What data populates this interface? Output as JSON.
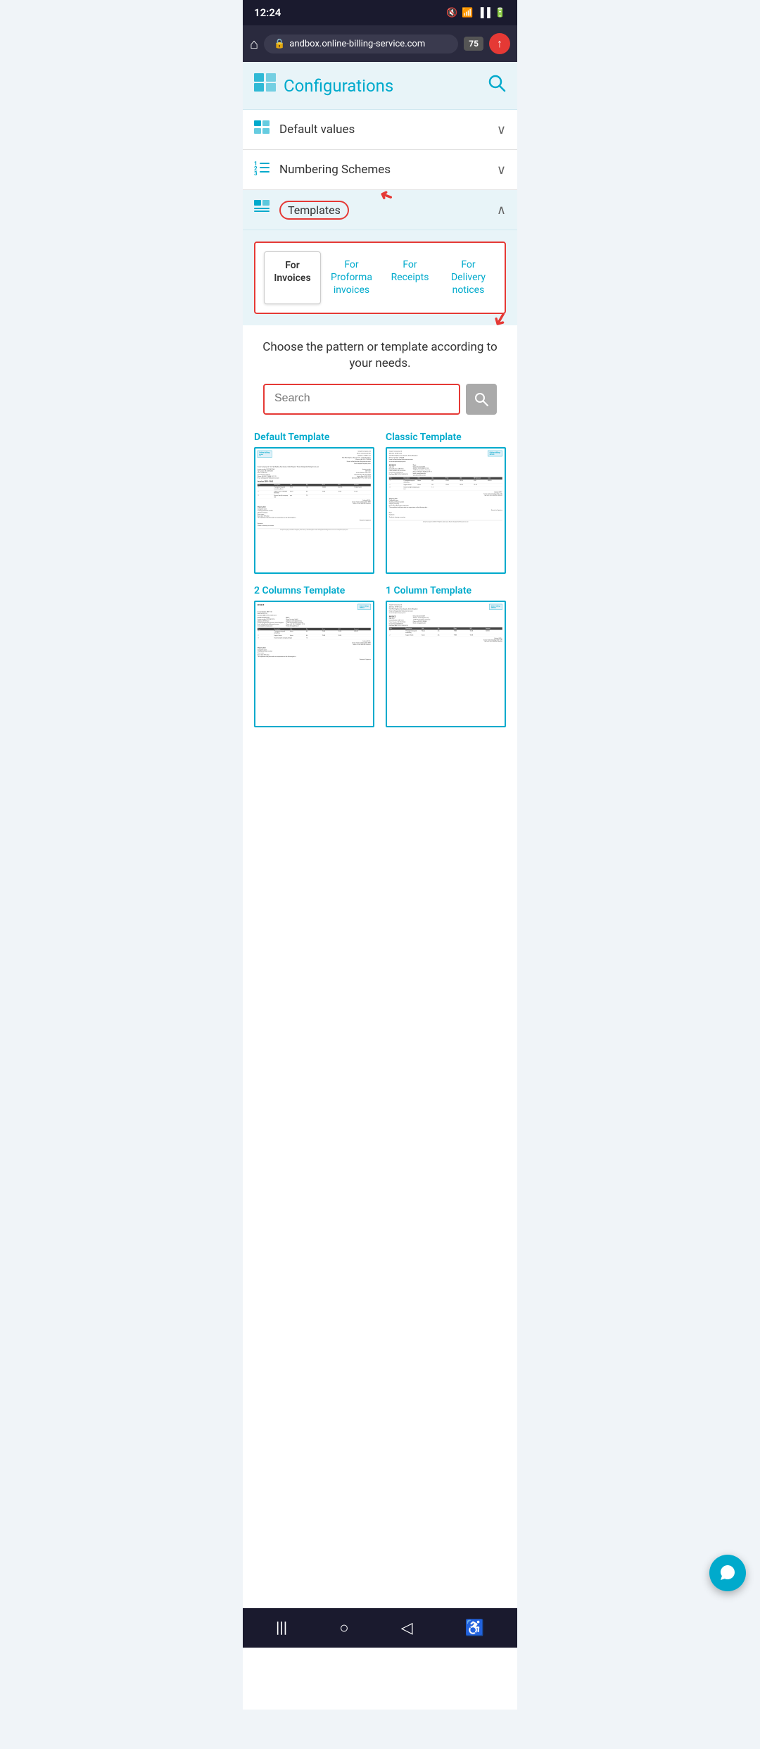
{
  "statusBar": {
    "time": "12:24",
    "personIcon": "🧑",
    "wifiIcon": "📶",
    "signalIcon": "📶",
    "batteryIcon": "🔋"
  },
  "browserBar": {
    "homeIcon": "⌂",
    "lockIcon": "🔒",
    "url": "andbox.online-billing-service.com",
    "tabCount": "75",
    "uploadIcon": "⬆"
  },
  "header": {
    "title": "Configurations",
    "searchIcon": "🔍"
  },
  "menuItems": [
    {
      "id": "default-values",
      "icon": "🖥",
      "label": "Default values",
      "arrow": "⌄",
      "expanded": false
    },
    {
      "id": "numbering-schemes",
      "icon": "☰",
      "label": "Numbering Schemes",
      "arrow": "⌄",
      "expanded": false
    }
  ],
  "templatesSection": {
    "icon": "▦",
    "label": "Templates",
    "arrow": "∧",
    "expanded": true
  },
  "templateTabs": [
    {
      "id": "invoices",
      "label": "For\nInvoices",
      "active": true
    },
    {
      "id": "proforma",
      "label": "For\nProforma\ninvoices",
      "active": false
    },
    {
      "id": "receipts",
      "label": "For\nReceipts",
      "active": false
    },
    {
      "id": "delivery",
      "label": "For\nDelivery\nnotices",
      "active": false
    }
  ],
  "contentSection": {
    "chooseText": "Choose the pattern or template according to your needs.",
    "searchPlaceholder": "Search"
  },
  "templateCards": [
    {
      "id": "default",
      "title": "Default Template",
      "selected": true
    },
    {
      "id": "classic",
      "title": "Classic Template",
      "selected": false
    },
    {
      "id": "two-columns",
      "title": "2 Columns Template",
      "selected": false
    },
    {
      "id": "one-column",
      "title": "1 Column Template",
      "selected": false
    }
  ],
  "bottomNav": {
    "backIcon": "◁",
    "homeIcon": "○",
    "menuIcon": "|||",
    "accessibilityIcon": "♿"
  },
  "chatFab": {
    "icon": "💬"
  }
}
